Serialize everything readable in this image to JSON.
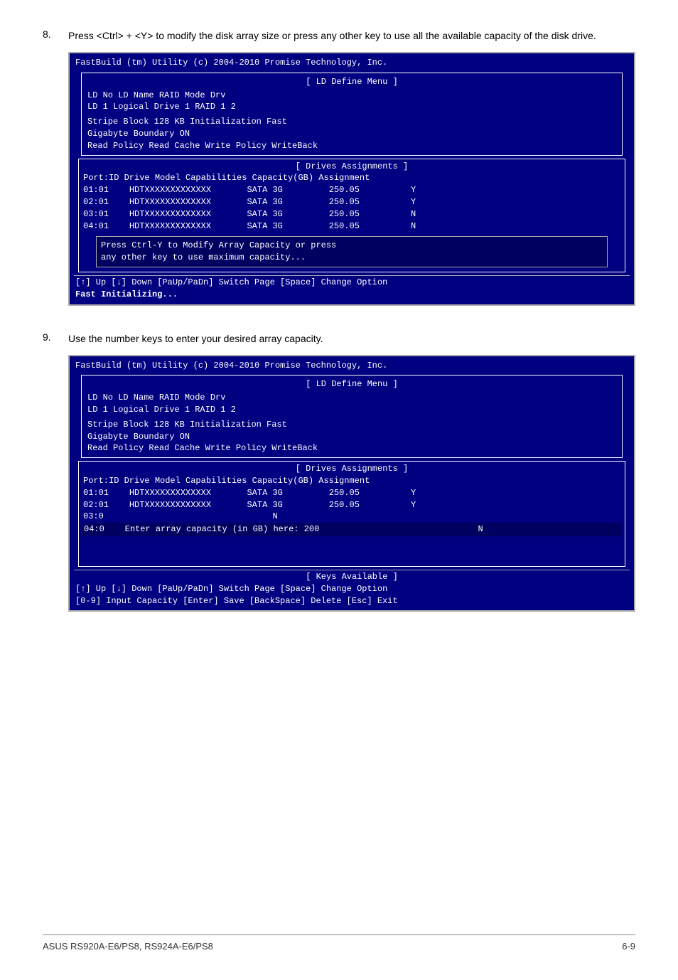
{
  "steps": [
    {
      "number": "8.",
      "text": "Press <Ctrl> + <Y> to modify the disk array size or press any other key to use all the available capacity of the disk drive.",
      "terminal": {
        "title_bar": "FastBuild (tm) Utility (c) 2004-2010 Promise Technology, Inc.",
        "menu_title": "[ LD Define Menu ]",
        "ld_info": {
          "header_row": "  LD No  LD Name                       RAID Mode     Drv",
          "ld_row": "  LD  1  Logical Drive 1               RAID 1        2"
        },
        "stripe_block": "  Stripe Block       128 KB            Initialization    Fast",
        "gigabyte_boundary": "  Gigabyte Boundary  ON",
        "read_policy": "  Read Policy        Read Cache        Write Policy      WriteBack",
        "drives_title": "[ Drives Assignments ]",
        "drives_header": "Port:ID  Drive Model          Capabilities     Capacity(GB)    Assignment",
        "drives": [
          {
            "id": "01:01",
            "model": "HDTXXXXXXXXXXXXX",
            "cap": "SATA 3G",
            "size": "250.05",
            "assign": "Y"
          },
          {
            "id": "02:01",
            "model": "HDTXXXXXXXXXXXXX",
            "cap": "SATA 3G",
            "size": "250.05",
            "assign": "Y"
          },
          {
            "id": "03:01",
            "model": "HDTXXXXXXXXXXXXX",
            "cap": "SATA 3G",
            "size": "250.05",
            "assign": "N"
          },
          {
            "id": "04:01",
            "model": "HDTXXXXXXXXXXXXX",
            "cap": "SATA 3G",
            "size": "250.05",
            "assign": "N"
          }
        ],
        "press_message_line1": "Press Ctrl-Y to Modify Array Capacity or press",
        "press_message_line2": "any other key to use maximum capacity...",
        "nav_bar": "[↑] Up [↓] Down [PaUp/PaDn] Switch Page [Space] Change Option",
        "status": "Fast Initializing..."
      }
    },
    {
      "number": "9.",
      "text": "Use the number keys to enter your desired array capacity.",
      "terminal": {
        "title_bar": "FastBuild (tm) Utility (c) 2004-2010 Promise Technology, Inc.",
        "menu_title": "[ LD Define Menu ]",
        "ld_info": {
          "header_row": "  LD No  LD Name                       RAID Mode     Drv",
          "ld_row": "  LD  1  Logical Drive 1               RAID 1        2"
        },
        "stripe_block": "  Stripe Block       128 KB            Initialization    Fast",
        "gigabyte_boundary": "  Gigabyte Boundary  ON",
        "read_policy": "  Read Policy        Read Cache        Write Policy      WriteBack",
        "drives_title": "[ Drives Assignments ]",
        "drives_header": "Port:ID  Drive Model          Capabilities     Capacity(GB)    Assignment",
        "drives": [
          {
            "id": "01:01",
            "model": "HDTXXXXXXXXXXXXX",
            "cap": "SATA 3G",
            "size": "250.05",
            "assign": "Y"
          },
          {
            "id": "02:01",
            "model": "HDTXXXXXXXXXXXXX",
            "cap": "SATA 3G",
            "size": "250.05",
            "assign": "Y"
          },
          {
            "id": "03:0",
            "model": "",
            "cap": "",
            "size": "",
            "assign": "N"
          },
          {
            "id": "04:0",
            "model": "Enter array capacity (in GB) here: 200",
            "cap": "",
            "size": "",
            "assign": "N"
          }
        ],
        "keys_title": "[ Keys Available ]",
        "nav_bar": "[↑] Up [↓] Down [PaUp/PaDn] Switch Page [Space] Change Option",
        "keys_bar": "[0-9] Input Capacity [Enter] Save [BackSpace] Delete [Esc] Exit"
      }
    }
  ],
  "footer": {
    "left": "ASUS RS920A-E6/PS8, RS924A-E6/PS8",
    "right": "6-9"
  }
}
